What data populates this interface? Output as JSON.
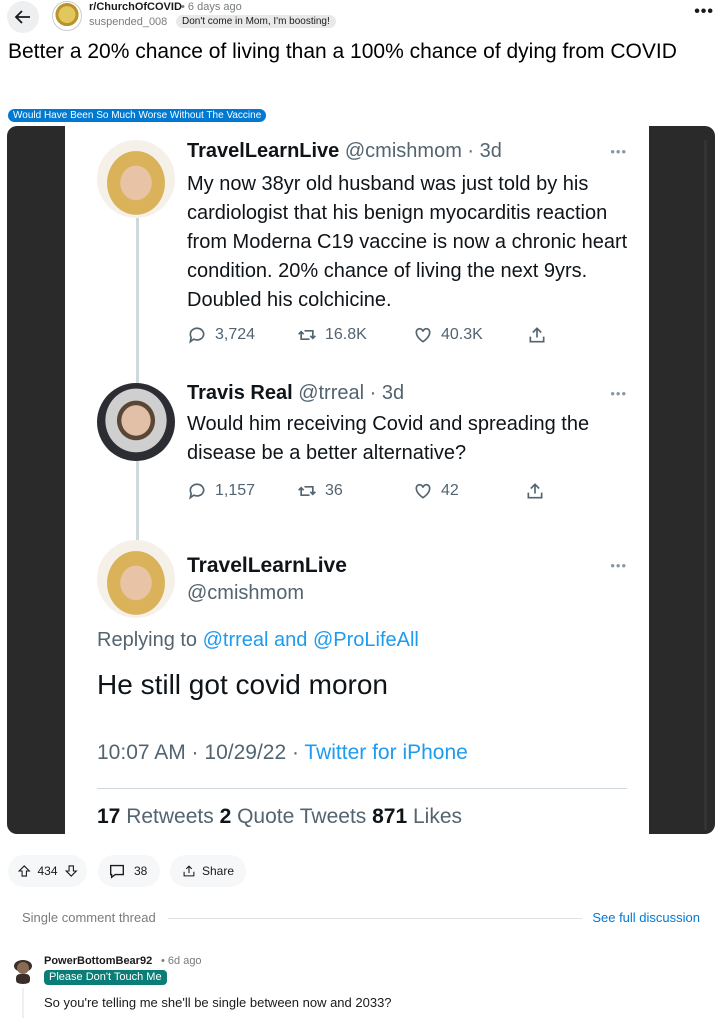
{
  "header": {
    "subreddit": "r/ChurchOfCOVID",
    "post_age": "• 6 days ago",
    "author": "suspended_008",
    "author_flair": "Don't come in Mom, I'm boosting!",
    "more": "•••"
  },
  "post": {
    "title": "Better a 20% chance of living than a 100% chance of dying from COVID",
    "flair": "Would Have Been So Much Worse Without The Vaccine"
  },
  "screenshot": {
    "tweet1": {
      "name": "TravelLearnLive",
      "handle_time": "@cmishmom · 3d",
      "text": "My now 38yr old husband was just told by his cardiologist that his benign myocarditis reaction from Moderna C19 vaccine is now a chronic heart condition. 20% chance of living the next 9yrs. Doubled his colchicine.",
      "replies": "3,724",
      "retweets": "16.8K",
      "likes": "40.3K"
    },
    "tweet2": {
      "name": "Travis Real",
      "handle_time": "@trreal · 3d",
      "text": "Would him receiving Covid and spreading the disease be a better alternative?",
      "replies": "1,157",
      "retweets": "36",
      "likes": "42"
    },
    "tweet3": {
      "name": "TravelLearnLive",
      "handle": "@cmishmom",
      "replying_prefix": "Replying to ",
      "replying_users": "@trreal and @ProLifeAll",
      "text": "He still got covid moron",
      "time": "10:07 AM · 10/29/22 · ",
      "source": "Twitter for iPhone",
      "retweets_count": "17",
      "retweets_label": " Retweets ",
      "quotes_count": "2",
      "quotes_label": " Quote Tweets ",
      "likes_count": "871",
      "likes_label": " Likes"
    },
    "dots": "•••"
  },
  "actions": {
    "votes": "434",
    "comments": "38",
    "share": "Share"
  },
  "thread": {
    "label": "Single comment thread",
    "full_link": "See full discussion"
  },
  "comment": {
    "user": "PowerBottomBear92",
    "age": "• 6d ago",
    "flair": "Please Don't Touch Me",
    "body": "So you're telling me she'll be single between now and 2033?"
  }
}
